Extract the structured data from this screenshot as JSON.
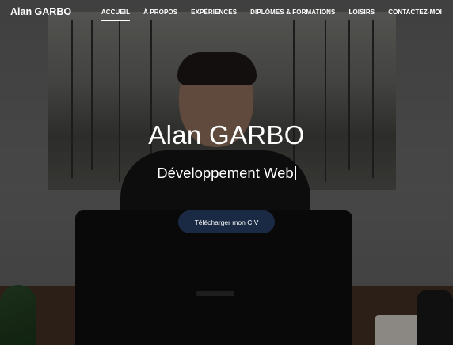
{
  "brand": "Alan GARBO",
  "nav": {
    "items": [
      {
        "label": "ACCUEIL",
        "active": true
      },
      {
        "label": "À PROPOS"
      },
      {
        "label": "EXPÉRIENCES"
      },
      {
        "label": "DIPLÔMES & FORMATIONS"
      },
      {
        "label": "LOISIRS"
      },
      {
        "label": "CONTACTEZ-MOI"
      }
    ]
  },
  "hero": {
    "title": "Alan GARBO",
    "subtitle": "Développement Web",
    "cta_label": "Télécharger mon C.V"
  },
  "colors": {
    "cta_bg": "#1b2a44",
    "text": "#ffffff"
  }
}
